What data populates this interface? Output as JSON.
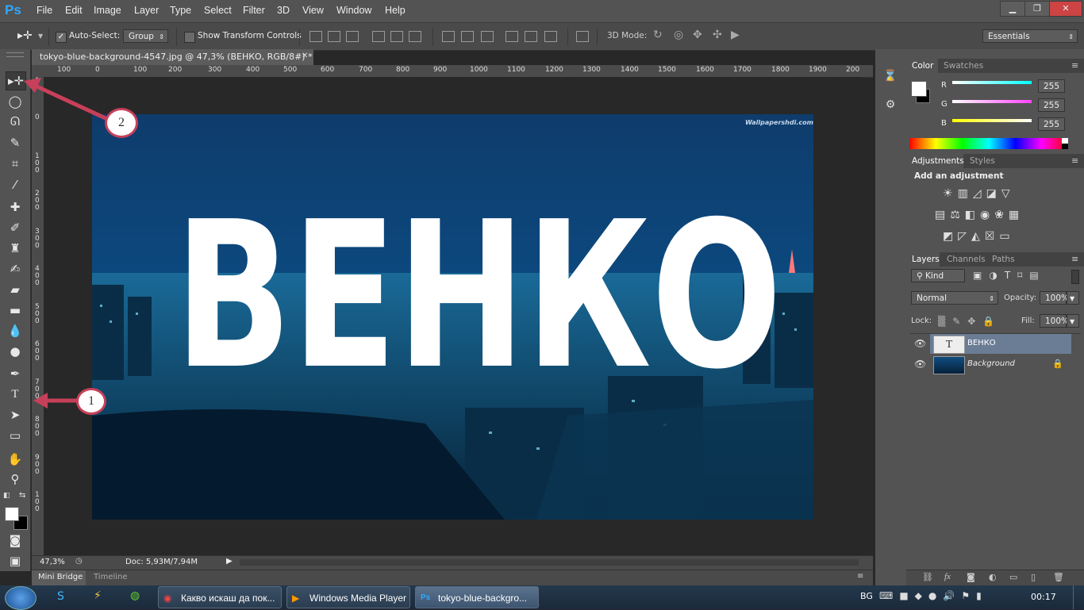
{
  "app": {
    "logo": "Ps"
  },
  "menu": [
    "File",
    "Edit",
    "Image",
    "Layer",
    "Type",
    "Select",
    "Filter",
    "3D",
    "View",
    "Window",
    "Help"
  ],
  "window_controls": {
    "minimize": "▁",
    "restore": "❐",
    "close": "✕"
  },
  "options_bar": {
    "auto_select_label": "Auto-Select:",
    "auto_select_checked": true,
    "auto_select_value": "Group",
    "show_transform_label": "Show Transform Controls",
    "mode_3d_label": "3D Mode:",
    "workspace": "Essentials"
  },
  "document": {
    "tab_title": "tokyo-blue-background-4547.jpg @ 47,3% (ВЕНКО, RGB/8#) *",
    "ruler_top": [
      "100",
      "0",
      "100",
      "200",
      "300",
      "400",
      "500",
      "600",
      "700",
      "800",
      "900",
      "1000",
      "1100",
      "1200",
      "1300",
      "1400",
      "1500",
      "1600",
      "1700",
      "1800",
      "1900",
      "200"
    ],
    "ruler_left": [
      "1",
      "0",
      "0",
      "1",
      "0",
      "0",
      "2",
      "0",
      "0",
      "3",
      "0",
      "0",
      "4",
      "0",
      "0",
      "5",
      "0",
      "0",
      "6",
      "0",
      "0",
      "7",
      "0",
      "0",
      "8",
      "0",
      "0",
      "9",
      "0",
      "0",
      "1",
      "0",
      "0"
    ],
    "watermark": "Wallpapershdi.com",
    "canvas_text": "ВЕНКО",
    "zoom": "47,3%",
    "doc_size": "Doc: 5,93M/7,94M"
  },
  "bottom_tabs": [
    "Mini Bridge",
    "Timeline"
  ],
  "color_panel": {
    "tabs": [
      "Color",
      "Swatches"
    ],
    "channels": [
      {
        "label": "R",
        "value": "255",
        "color": "#00ffff"
      },
      {
        "label": "G",
        "value": "255",
        "color": "#ff40ff"
      },
      {
        "label": "B",
        "value": "255",
        "color": "#ffff00"
      }
    ]
  },
  "adjustments_panel": {
    "tabs": [
      "Adjustments",
      "Styles"
    ],
    "title": "Add an adjustment"
  },
  "layers_panel": {
    "tabs": [
      "Layers",
      "Channels",
      "Paths"
    ],
    "filter": "Kind",
    "blend_mode": "Normal",
    "opacity_label": "Opacity:",
    "opacity": "100%",
    "lock_label": "Lock:",
    "fill_label": "Fill:",
    "fill": "100%",
    "layers": [
      {
        "name": "ВЕНКО",
        "type": "text",
        "selected": true
      },
      {
        "name": "Background",
        "type": "image",
        "selected": false
      }
    ]
  },
  "annotations": [
    "1",
    "2"
  ],
  "taskbar": {
    "items": [
      "Какво искаш да пок...",
      "Windows Media Player",
      "tokyo-blue-backgro..."
    ],
    "lang": "BG",
    "time": "00:17"
  },
  "colors": {
    "accent": "#30a8ff",
    "annotation": "#c7405a",
    "panel": "#535353"
  }
}
